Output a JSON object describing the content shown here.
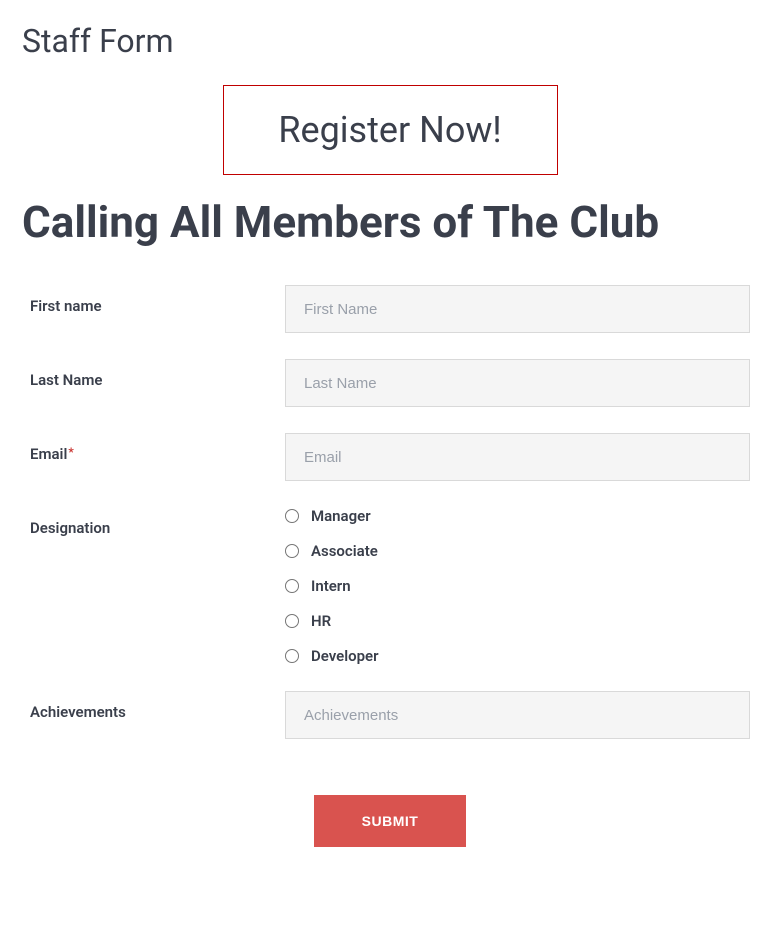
{
  "page_title": "Staff Form",
  "register_banner": "Register Now!",
  "subheading": "Calling All Members of The Club",
  "form": {
    "first_name": {
      "label": "First name",
      "placeholder": "First Name"
    },
    "last_name": {
      "label": "Last Name",
      "placeholder": "Last Name"
    },
    "email": {
      "label": "Email",
      "required_mark": "*",
      "placeholder": "Email"
    },
    "designation": {
      "label": "Designation",
      "options": {
        "0": "Manager",
        "1": "Associate",
        "2": "Intern",
        "3": "HR",
        "4": "Developer"
      }
    },
    "achievements": {
      "label": "Achievements",
      "placeholder": "Achievements"
    },
    "submit_label": "SUBMIT"
  }
}
